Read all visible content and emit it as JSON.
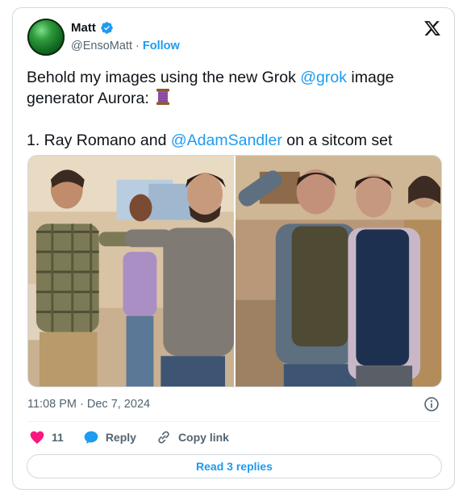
{
  "author": {
    "name": "Matt",
    "handle": "@EnsoMatt",
    "separator": "·",
    "follow_label": "Follow"
  },
  "tweet": {
    "line1_prefix": "Behold my images using the new Grok ",
    "line1_mention": "@grok",
    "line1_suffix": " image generator Aurora: ",
    "line2_prefix": "1. Ray Romano and ",
    "line2_mention": "@AdamSandler",
    "line2_suffix": " on a sitcom set"
  },
  "meta": {
    "timestamp": "11:08 PM · Dec 7, 2024"
  },
  "actions": {
    "like_count": "11",
    "reply_label": "Reply",
    "copy_link_label": "Copy link"
  },
  "footer": {
    "read_replies_label": "Read 3 replies"
  },
  "colors": {
    "accent": "#1d9bf0",
    "like": "#f91880",
    "muted": "#536471"
  },
  "icons": [
    "verified-icon",
    "x-logo-icon",
    "spool-icon",
    "info-icon",
    "heart-icon",
    "reply-bubble-icon",
    "link-icon"
  ]
}
